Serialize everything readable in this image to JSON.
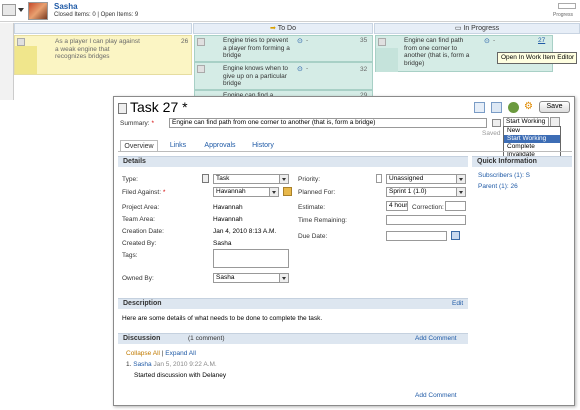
{
  "board": {
    "owner_name": "Sasha",
    "owner_stats": "Closed Items: 0 | Open Items: 9",
    "progress_label": "Progress",
    "columns": [
      {
        "label": "To Do",
        "icon": "arrow-right-icon"
      },
      {
        "label": "In Progress",
        "icon": "inbox-icon"
      }
    ],
    "cards": [
      {
        "text": "As a player I can play against a weak engine that recognizes bridges",
        "number": "26"
      },
      {
        "text": "Engine tries to prevent a player from forming a bridge",
        "number": "35",
        "extra": "-"
      },
      {
        "text": "Engine knows when to give up on a particular bridge",
        "number": "32",
        "extra": "-"
      },
      {
        "text": "Engine can find a",
        "number": "29"
      },
      {
        "text": "Engine can find path from one corner to another (that is, form a bridge)",
        "number": "27",
        "extra": "-"
      }
    ],
    "tooltip": "Open In Work Item Editor"
  },
  "dialog": {
    "title": "Task 27 *",
    "save_label": "Save",
    "summary_label": "Summary:",
    "summary_value": "Engine can find path from one corner to another (that is, form a bridge)",
    "saved_label": "Saved",
    "workflow": {
      "selected": "Start Working",
      "options": [
        "New",
        "Start Working",
        "Complete",
        "Invalidate"
      ],
      "highlighted": "Start Working"
    },
    "tabs": [
      "Overview",
      "Links",
      "Approvals",
      "History"
    ],
    "details": {
      "header": "Details",
      "type_label": "Type:",
      "type_value": "Task",
      "filed_label": "Filed Against:",
      "filed_value": "Havannah",
      "project_label": "Project Area:",
      "project_value": "Havannah",
      "team_label": "Team Area:",
      "team_value": "Havannah",
      "created_label": "Creation Date:",
      "created_value": "Jan 4, 2010 8:13 A.M.",
      "createdby_label": "Created By:",
      "createdby_value": "Sasha",
      "tags_label": "Tags:",
      "owned_label": "Owned By:",
      "owned_value": "Sasha",
      "priority_label": "Priority:",
      "priority_value": "Unassigned",
      "planned_label": "Planned For:",
      "planned_value": "Sprint 1 (1.0)",
      "estimate_label": "Estimate:",
      "estimate_value": "4 hour",
      "correction_label": "Correction:",
      "remaining_label": "Time Remaining:",
      "due_label": "Due Date:"
    },
    "quick": {
      "header": "Quick Information",
      "subscribers": "Subscribers (1): S",
      "parent": "Parent (1): 26"
    },
    "description": {
      "header": "Description",
      "edit": "Edit",
      "text": "Here are some details of what needs to be done to complete the task."
    },
    "discussion": {
      "header": "Discussion",
      "count": "(1 comment)",
      "add": "Add Comment",
      "collapse": "Collapse All",
      "expand": "Expand All",
      "comment_num": "1.",
      "comment_author": "Sasha",
      "comment_date": "Jan 5, 2010 9:22 A.M.",
      "comment_text": "Started discussion with Delaney",
      "add_bottom": "Add Comment"
    }
  }
}
